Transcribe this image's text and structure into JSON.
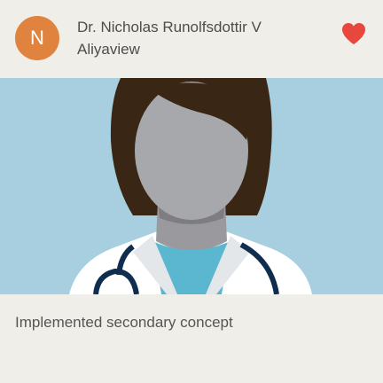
{
  "profile": {
    "avatar_initial": "N",
    "name": "Dr. Nicholas Runolfsdottir V",
    "location": "Aliyaview"
  },
  "actions": {
    "favorite_icon": "heart-icon",
    "favorite_color": "#e8473e"
  },
  "media": {
    "image_subject": "doctor-illustration",
    "background_color": "#a8cfe0"
  },
  "post": {
    "caption": "Implemented secondary concept"
  },
  "colors": {
    "avatar_bg": "#e0833e",
    "card_bg": "#efeee8"
  }
}
